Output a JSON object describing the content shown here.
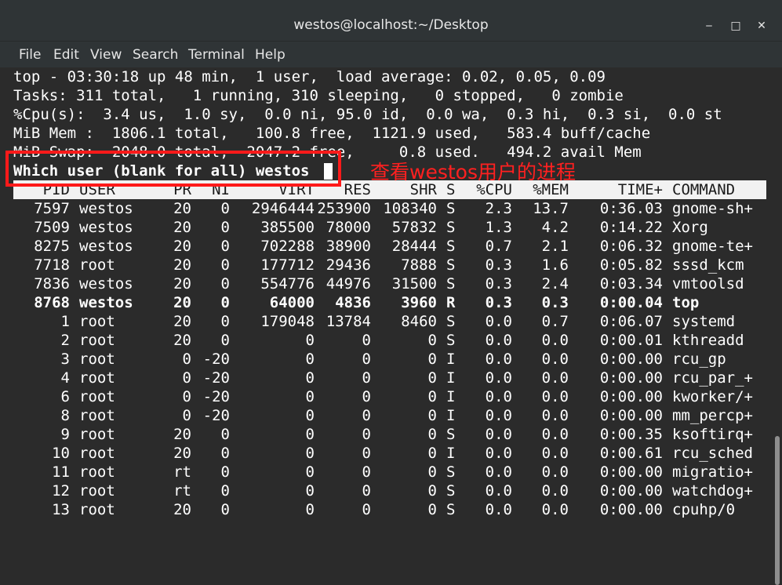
{
  "window": {
    "title": "westos@localhost:~/Desktop",
    "minimize": "‒",
    "maximize": "□",
    "close": "✕"
  },
  "menu": [
    "File",
    "Edit",
    "View",
    "Search",
    "Terminal",
    "Help"
  ],
  "summary": [
    "top - 03:30:18 up 48 min,  1 user,  load average: 0.02, 0.05, 0.09",
    "Tasks: 311 total,   1 running, 310 sleeping,   0 stopped,   0 zombie",
    "%Cpu(s):  3.4 us,  1.0 sy,  0.0 ni, 95.0 id,  0.0 wa,  0.3 hi,  0.3 si,  0.0 st",
    "MiB Mem :  1806.1 total,   100.8 free,  1121.9 used,   583.4 buff/cache",
    "MiB Swap:  2048.0 total,  2047.2 free,     0.8 used.   494.2 avail Mem"
  ],
  "prompt": "Which user (blank for all) westos",
  "annotation": "查看westos用户的进程",
  "columns": [
    "PID",
    "USER",
    "PR",
    "NI",
    "VIRT",
    "RES",
    "SHR",
    "S",
    "%CPU",
    "%MEM",
    "TIME+",
    "COMMAND"
  ],
  "processes": [
    [
      "7597",
      "westos",
      "20",
      "0",
      "2946444",
      "253900",
      "108340",
      "S",
      "2.3",
      "13.7",
      "0:36.03",
      "gnome-sh+"
    ],
    [
      "7509",
      "westos",
      "20",
      "0",
      "385500",
      "78000",
      "57832",
      "S",
      "1.3",
      "4.2",
      "0:14.22",
      "Xorg"
    ],
    [
      "8275",
      "westos",
      "20",
      "0",
      "702288",
      "38900",
      "28444",
      "S",
      "0.7",
      "2.1",
      "0:06.32",
      "gnome-te+"
    ],
    [
      "7718",
      "root",
      "20",
      "0",
      "177712",
      "29436",
      "7888",
      "S",
      "0.3",
      "1.6",
      "0:05.82",
      "sssd_kcm"
    ],
    [
      "7836",
      "westos",
      "20",
      "0",
      "554776",
      "44976",
      "31500",
      "S",
      "0.3",
      "2.4",
      "0:03.34",
      "vmtoolsd"
    ],
    [
      "8768",
      "westos",
      "20",
      "0",
      "64000",
      "4836",
      "3960",
      "R",
      "0.3",
      "0.3",
      "0:00.04",
      "top"
    ],
    [
      "1",
      "root",
      "20",
      "0",
      "179048",
      "13784",
      "8460",
      "S",
      "0.0",
      "0.7",
      "0:06.07",
      "systemd"
    ],
    [
      "2",
      "root",
      "20",
      "0",
      "0",
      "0",
      "0",
      "S",
      "0.0",
      "0.0",
      "0:00.01",
      "kthreadd"
    ],
    [
      "3",
      "root",
      "0",
      "-20",
      "0",
      "0",
      "0",
      "I",
      "0.0",
      "0.0",
      "0:00.00",
      "rcu_gp"
    ],
    [
      "4",
      "root",
      "0",
      "-20",
      "0",
      "0",
      "0",
      "I",
      "0.0",
      "0.0",
      "0:00.00",
      "rcu_par_+"
    ],
    [
      "6",
      "root",
      "0",
      "-20",
      "0",
      "0",
      "0",
      "I",
      "0.0",
      "0.0",
      "0:00.00",
      "kworker/+"
    ],
    [
      "8",
      "root",
      "0",
      "-20",
      "0",
      "0",
      "0",
      "I",
      "0.0",
      "0.0",
      "0:00.00",
      "mm_percp+"
    ],
    [
      "9",
      "root",
      "20",
      "0",
      "0",
      "0",
      "0",
      "S",
      "0.0",
      "0.0",
      "0:00.35",
      "ksoftirq+"
    ],
    [
      "10",
      "root",
      "20",
      "0",
      "0",
      "0",
      "0",
      "I",
      "0.0",
      "0.0",
      "0:00.61",
      "rcu_sched"
    ],
    [
      "11",
      "root",
      "rt",
      "0",
      "0",
      "0",
      "0",
      "S",
      "0.0",
      "0.0",
      "0:00.00",
      "migratio+"
    ],
    [
      "12",
      "root",
      "rt",
      "0",
      "0",
      "0",
      "0",
      "S",
      "0.0",
      "0.0",
      "0:00.00",
      "watchdog+"
    ],
    [
      "13",
      "root",
      "20",
      "0",
      "0",
      "0",
      "0",
      "S",
      "0.0",
      "0.0",
      "0:00.00",
      "cpuhp/0"
    ]
  ],
  "highlighted_pid": "8768",
  "colors": {
    "annotation": "#ff1a1a",
    "header_bg": "#f2f2f2",
    "terminal_bg": "#2b2b2b"
  }
}
